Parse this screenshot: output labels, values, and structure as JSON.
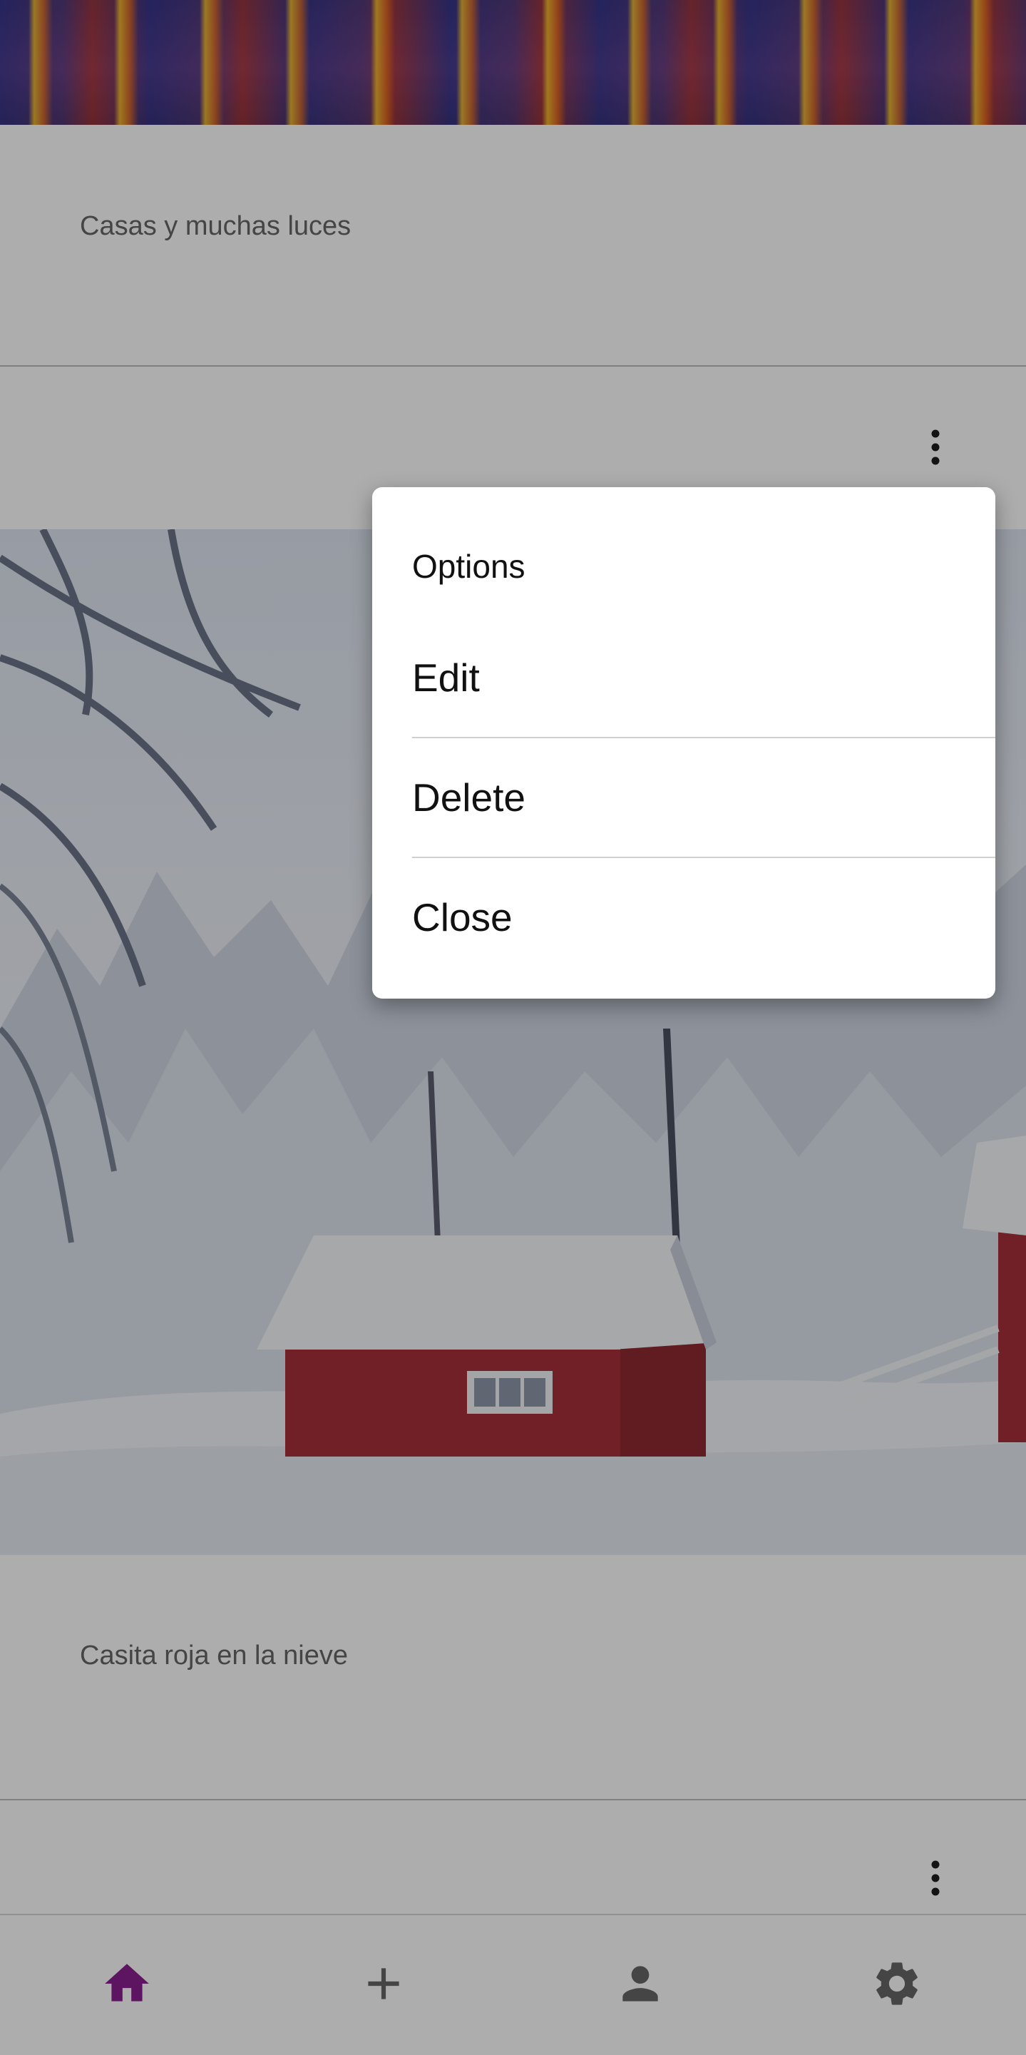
{
  "feed": {
    "posts": [
      {
        "caption": "Casas y muchas luces"
      },
      {
        "caption": "Casita roja en la nieve"
      }
    ]
  },
  "menu": {
    "title": "Options",
    "items": [
      {
        "label": "Edit"
      },
      {
        "label": "Delete"
      },
      {
        "label": "Close"
      }
    ]
  },
  "bottom_nav": {
    "items": [
      {
        "icon": "home-icon",
        "active": true
      },
      {
        "icon": "plus-icon",
        "active": false
      },
      {
        "icon": "person-icon",
        "active": false
      },
      {
        "icon": "gear-icon",
        "active": false
      }
    ]
  },
  "colors": {
    "accent": "#8a1f8f",
    "nav_icon": "#666666",
    "scrim": "rgba(0,0,0,0.32)"
  }
}
